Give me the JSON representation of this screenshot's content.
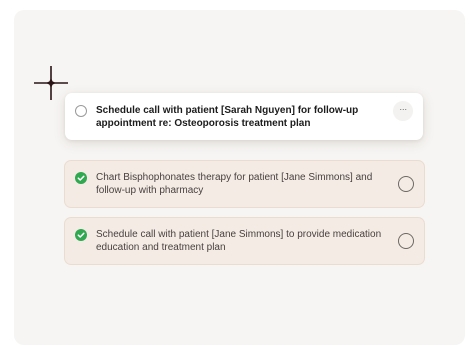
{
  "tasks": {
    "dragging": {
      "text": "Schedule call with patient [Sarah Nguyen] for follow-up appointment re: Osteoporosis treatment plan",
      "more_label": "···",
      "state": "unchecked",
      "icon": "radio-empty-icon"
    },
    "items": [
      {
        "text": "Chart Bisphophonates therapy for patient [Jane Simmons] and follow-up with pharmacy",
        "state": "checked",
        "icon": "check-circle-icon"
      },
      {
        "text": "Schedule call with patient [Jane Simmons] to provide medication education and treatment plan",
        "state": "checked",
        "icon": "check-circle-icon"
      }
    ]
  },
  "colors": {
    "panel_background": "#f7f5f3",
    "done_card_background": "#f3ebe4",
    "check_green": "#2fa84f",
    "cursor": "#2a1416"
  },
  "cursor": {
    "icon": "crosshair-cursor-icon"
  }
}
